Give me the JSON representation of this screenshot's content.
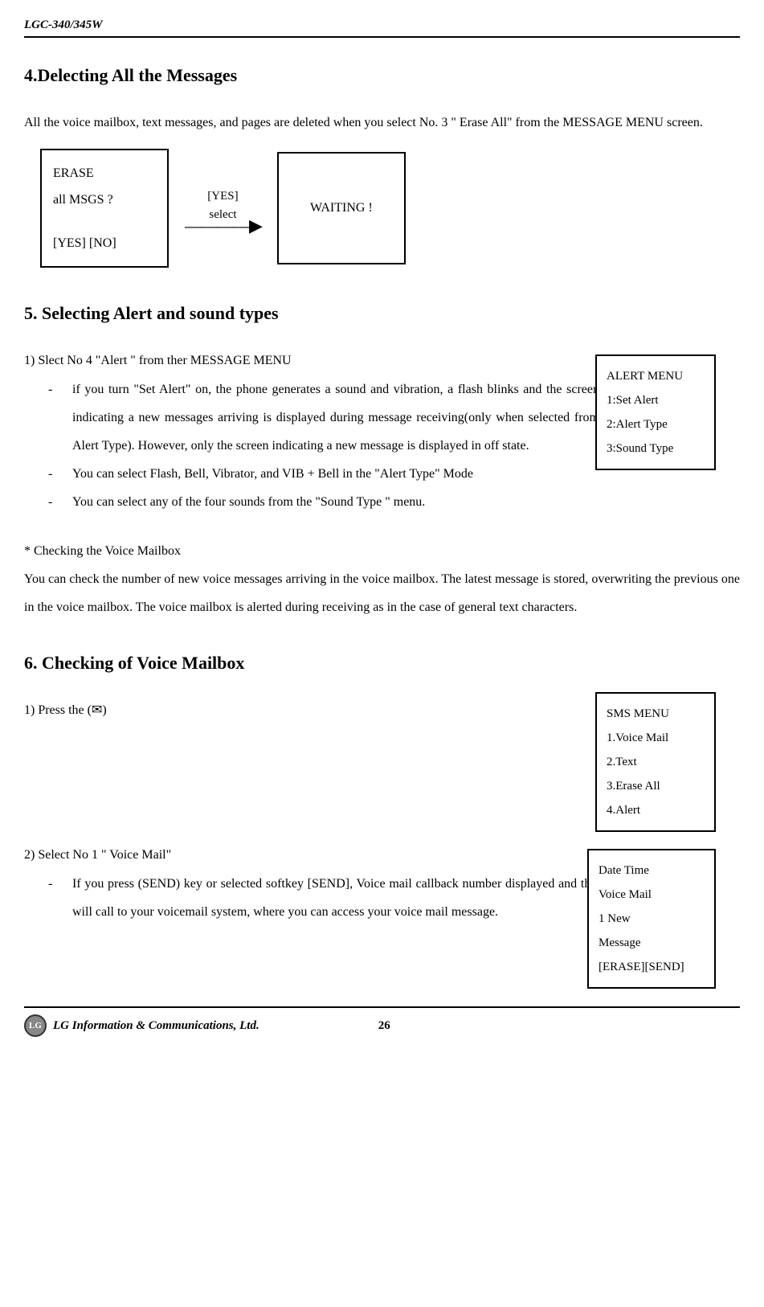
{
  "header": {
    "model": "LGC-340/345W"
  },
  "section4": {
    "title": "4.Delecting All the Messages",
    "body": "All the voice mailbox, text messages, and pages are deleted when you select No. 3 \" Erase All\" from the MESSAGE MENU screen.",
    "box1_line1": "ERASE",
    "box1_line2": "all    MSGS ?",
    "box1_line3": "[YES]    [NO]",
    "arrow_top": "[YES]",
    "arrow_bottom": "select",
    "box2": "WAITING !"
  },
  "section5": {
    "title": "5. Selecting Alert and sound types",
    "item1": "1)   Slect No 4 \"Alert \" from ther MESSAGE MENU",
    "bullet1": "if you turn \"Set Alert\" on, the phone generates a sound and vibration, a flash blinks and the screen indicating a new messages    arriving is displayed during message receiving(only when selected from Alert Type). However, only the screen indicating a new message is displayed in off state.",
    "bullet2": "You can select Flash, Bell, Vibrator, and VIB + Bell in the \"Alert Type\" Mode",
    "bullet3": "You can select any of the four sounds from the \"Sound Type \" menu.",
    "sidebox_l1": "ALERT MENU",
    "sidebox_l2": "1:Set Alert",
    "sidebox_l3": "2:Alert Type",
    "sidebox_l4": "3:Sound Type",
    "note_title": "* Checking the Voice Mailbox",
    "note_body": "You can check the number of new voice messages arriving in the voice mailbox. The latest message is stored, overwriting the previous one in the voice mailbox. The voice mailbox is alerted during receiving as in the case of general text characters."
  },
  "section6": {
    "title": "6. Checking of Voice Mailbox",
    "press": "1) Press the    (✉)",
    "sms_l1": "SMS MENU",
    "sms_l2": "1.Voice Mail",
    "sms_l3": "2.Text",
    "sms_l4": "3.Erase All",
    "sms_l5": "4.Alert",
    "item2": "2)   Select No 1 \" Voice Mail\"",
    "bullet1": "If you press (SEND) key or selected softkey [SEND], Voice mail callback number displayed and this will call to your voicemail system, where you can access your voice mail message.",
    "vm_l1": "Date      Time",
    "vm_l2": "Voice Mail",
    "vm_l3": "1 New",
    "vm_l4": "Message",
    "vm_l5": "[ERASE][SEND]"
  },
  "footer": {
    "company": "LG Information & Communications, Ltd.",
    "page": "26",
    "logo": "LG"
  }
}
